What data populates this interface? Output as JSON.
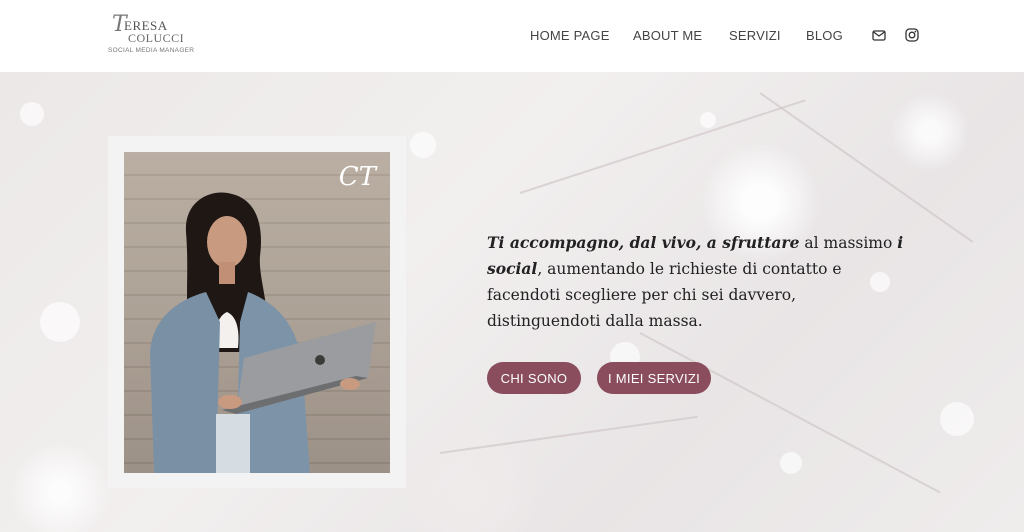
{
  "brand": {
    "line1": "ERESA",
    "initial": "T",
    "line2": "COLUCCI",
    "subtitle": "SOCIAL MEDIA MANAGER"
  },
  "nav": {
    "items": [
      {
        "label": "HOME PAGE"
      },
      {
        "label": "ABOUT ME"
      },
      {
        "label": "SERVIZI"
      },
      {
        "label": "BLOG"
      }
    ],
    "icons": [
      "mail-icon",
      "instagram-icon"
    ]
  },
  "hero": {
    "photo_monogram": "CT",
    "tagline_parts": [
      "Ti accompagno, dal vivo, a sfruttare",
      " al massimo ",
      "i social",
      ", aumentando le richieste di contatto e facendoti sceglie­re per chi sei davvero, distinguendoti dalla massa."
    ],
    "buttons": [
      {
        "label": "CHI SONO"
      },
      {
        "label": "I MIEI SERVIZI"
      }
    ]
  },
  "colors": {
    "accent": "#8a4d5e",
    "text": "#222222",
    "nav_text": "#444444"
  }
}
